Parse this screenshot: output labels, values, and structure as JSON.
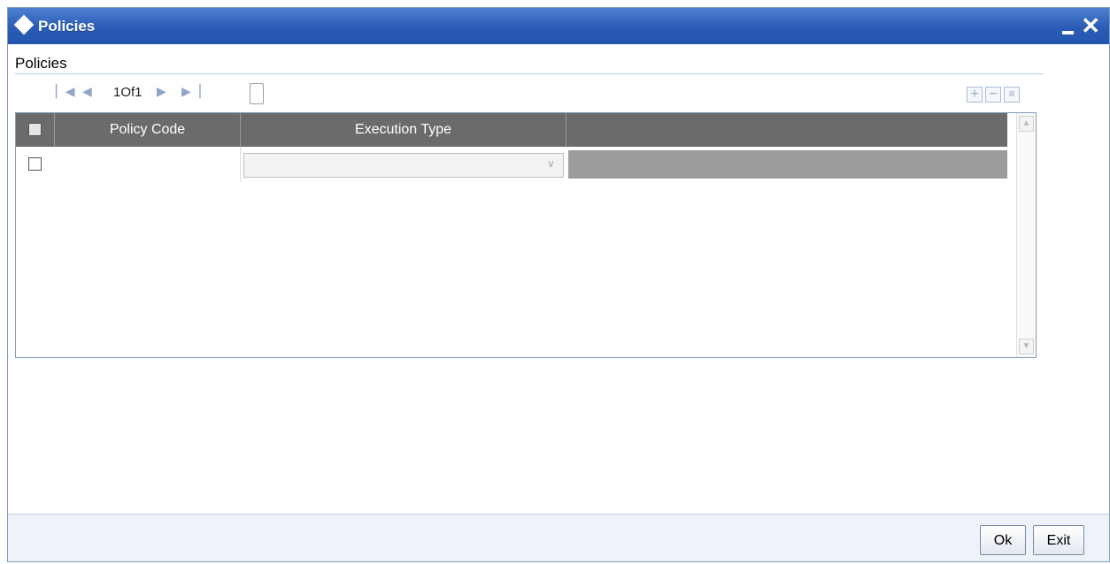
{
  "window": {
    "title": "Policies",
    "minimize_glyph": "_",
    "close_glyph": "✕"
  },
  "section": {
    "title": "Policies"
  },
  "pager": {
    "first_icon": "first-page-icon",
    "prev_icon": "prev-page-icon",
    "page_text": "1Of1",
    "next_icon": "next-page-icon",
    "last_icon": "last-page-icon"
  },
  "toolbar": {
    "add_icon": "plus-icon",
    "delete_icon": "minus-icon",
    "view_icon": "list-icon"
  },
  "grid": {
    "columns": [
      "Policy Code",
      "Execution Type"
    ],
    "rows": [
      {
        "policy_code": "",
        "execution_type": ""
      }
    ]
  },
  "footer": {
    "ok_label": "Ok",
    "exit_label": "Exit"
  },
  "colors": {
    "titlebar": "#2a5cb6",
    "grid_header": "#6b6b6b",
    "row_filler": "#9c9c9c"
  }
}
